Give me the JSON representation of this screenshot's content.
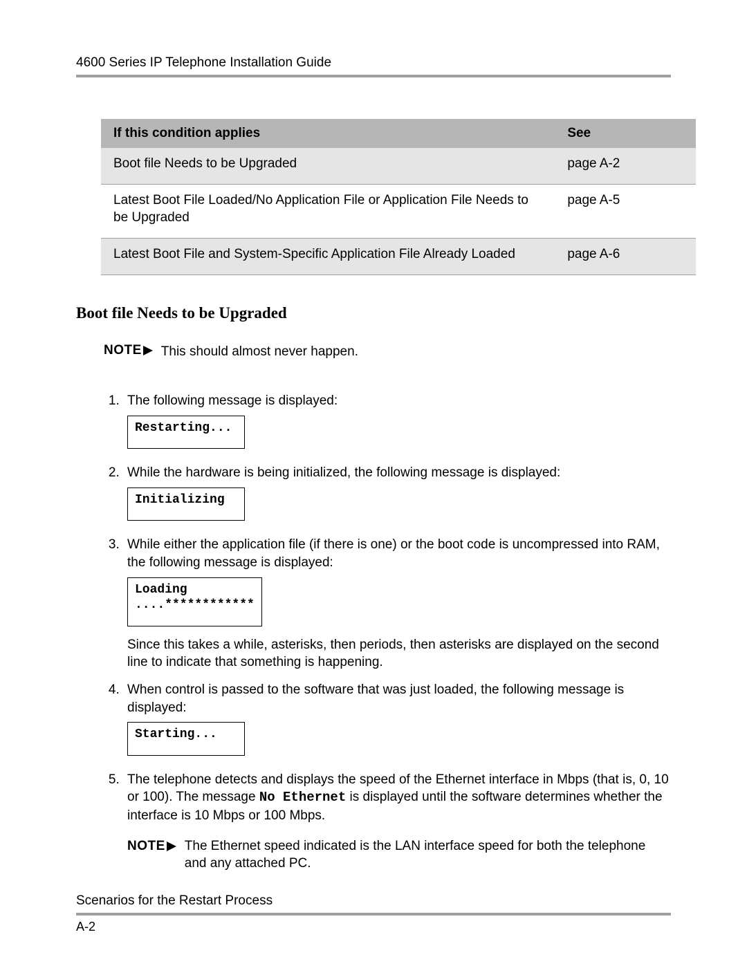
{
  "header": {
    "title": "4600 Series IP Telephone Installation Guide"
  },
  "table": {
    "headers": {
      "condition": "If this condition applies",
      "see": "See"
    },
    "rows": [
      {
        "condition": "Boot file Needs to be Upgraded",
        "see": "page A-2"
      },
      {
        "condition": "Latest Boot File Loaded/No Application File or Application File Needs to be Upgraded",
        "see": "page A-5"
      },
      {
        "condition": "Latest Boot File and System-Specific Application File Already Loaded",
        "see": "page A-6"
      }
    ]
  },
  "section_heading": "Boot file Needs to be Upgraded",
  "note_label": "NOTE",
  "top_note": "This should almost never happen.",
  "steps": {
    "s1": {
      "text": "The following message is displayed:",
      "box": "Restarting..."
    },
    "s2": {
      "text": "While the hardware is being initialized, the following message is displayed:",
      "box": "Initializing"
    },
    "s3": {
      "text": "While either the application file (if there is one) or the boot code is uncompressed into RAM, the following message is displayed:",
      "box": "Loading\n....************",
      "para": "Since this takes a while, asterisks, then periods, then asterisks are displayed on the second line to indicate that something is happening."
    },
    "s4": {
      "text": "When control is passed to the software that was just loaded, the following message is displayed:",
      "box": "Starting..."
    },
    "s5": {
      "text_a": "The telephone detects and displays the speed of the Ethernet interface in Mbps (that is, 0, 10 or 100). The message ",
      "mono": "No Ethernet",
      "text_b": " is displayed until the software determines whether the interface is 10 Mbps or 100 Mbps.",
      "note": "The Ethernet speed indicated is the LAN interface speed for both the telephone and any attached PC."
    }
  },
  "footer": {
    "title": "Scenarios for the Restart Process",
    "page": "A-2"
  }
}
